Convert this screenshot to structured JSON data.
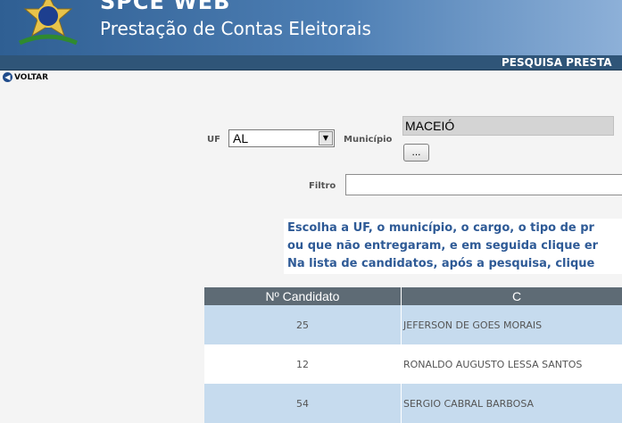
{
  "header": {
    "title": "SPCE WEB",
    "subtitle": "Prestação de Contas Eleitorais"
  },
  "page_bar": {
    "title": "PESQUISA PRESTA"
  },
  "nav": {
    "back_label": "VOLTAR"
  },
  "form": {
    "uf_label": "UF",
    "uf_value": "AL",
    "municipio_label": "Município",
    "municipio_value": "MACEIÓ",
    "lookup_button_label": "...",
    "filtro_label": "Filtro",
    "filtro_value": ""
  },
  "instructions": [
    "Escolha a UF, o município, o cargo, o tipo de pr",
    "ou que não entregaram, e em seguida clique er",
    "Na lista de candidatos, após a pesquisa, clique"
  ],
  "table": {
    "columns": [
      "Nº Candidato",
      "C"
    ],
    "rows": [
      {
        "numero": "25",
        "nome": "JEFERSON DE GOES MORAIS"
      },
      {
        "numero": "12",
        "nome": "RONALDO AUGUSTO LESSA SANTOS"
      },
      {
        "numero": "54",
        "nome": "SERGIO CABRAL BARBOSA"
      }
    ]
  },
  "colors": {
    "banner": "#3c6aa0",
    "page_bar": "#2f5578",
    "table_header": "#5e6b75",
    "row_alt": "#c6dbee",
    "instruction_text": "#2e5a96"
  }
}
